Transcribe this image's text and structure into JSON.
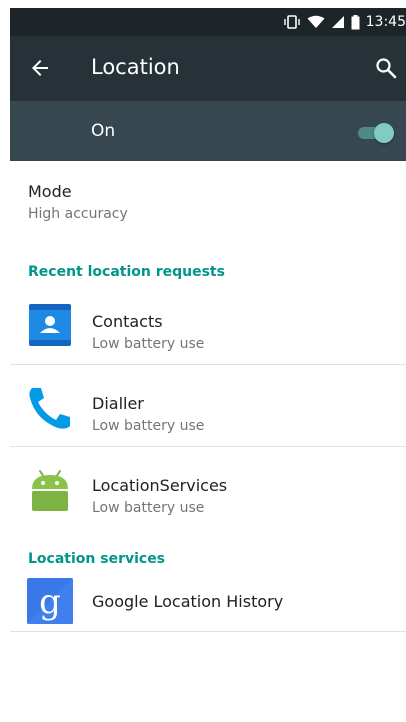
{
  "status_bar": {
    "time": "13:45"
  },
  "toolbar": {
    "title": "Location"
  },
  "master_switch": {
    "label": "On",
    "state": "on"
  },
  "mode": {
    "title": "Mode",
    "value": "High accuracy"
  },
  "recent_requests": {
    "header": "Recent location requests",
    "items": [
      {
        "name": "Contacts",
        "usage": "Low battery use",
        "icon": "contacts-icon"
      },
      {
        "name": "Dialler",
        "usage": "Low battery use",
        "icon": "phone-icon"
      },
      {
        "name": "LocationServices",
        "usage": "Low battery use",
        "icon": "android-icon"
      }
    ]
  },
  "location_services": {
    "header": "Location services",
    "items": [
      {
        "name": "Google Location History",
        "icon": "google-icon"
      }
    ]
  },
  "colors": {
    "accent": "#009688",
    "toolbar": "#263238",
    "switch_bar": "#37474f"
  }
}
